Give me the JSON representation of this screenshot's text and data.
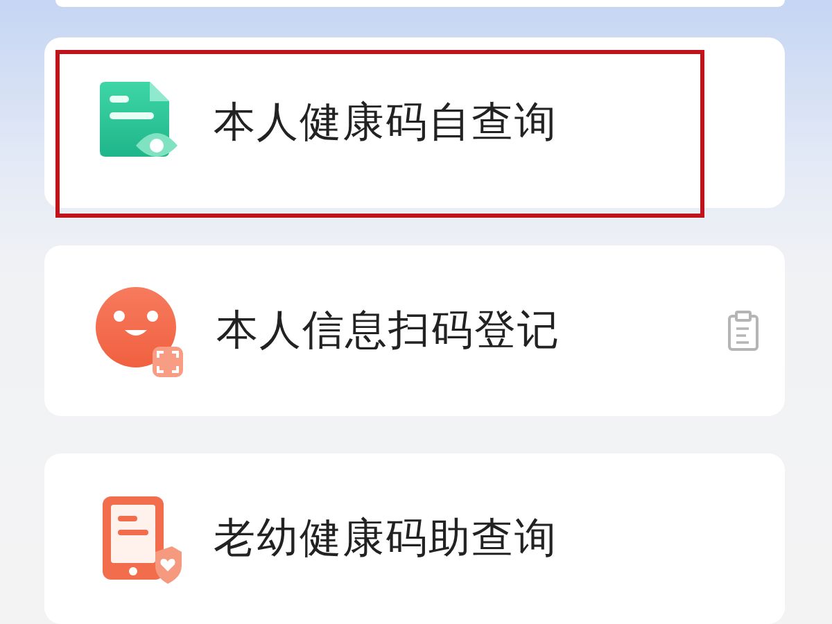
{
  "items": [
    {
      "label": "本人健康码自查询",
      "kind": "doc-eye",
      "highlighted": true,
      "has_side_icon": false
    },
    {
      "label": "本人信息扫码登记",
      "kind": "face-scan",
      "highlighted": false,
      "has_side_icon": true
    },
    {
      "label": "老幼健康码助查询",
      "kind": "tablet-shield",
      "highlighted": false,
      "has_side_icon": false
    }
  ]
}
